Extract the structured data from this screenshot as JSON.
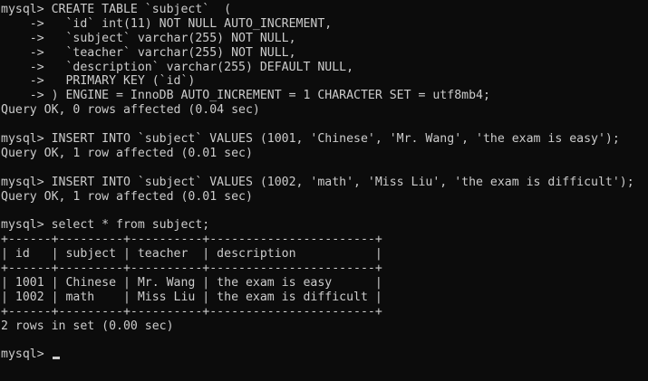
{
  "terminal": {
    "lines": [
      "mysql> CREATE TABLE `subject`  (",
      "    ->   `id` int(11) NOT NULL AUTO_INCREMENT,",
      "    ->   `subject` varchar(255) NOT NULL,",
      "    ->   `teacher` varchar(255) NOT NULL,",
      "    ->   `description` varchar(255) DEFAULT NULL,",
      "    ->   PRIMARY KEY (`id`)",
      "    -> ) ENGINE = InnoDB AUTO_INCREMENT = 1 CHARACTER SET = utf8mb4;",
      "Query OK, 0 rows affected (0.04 sec)",
      "",
      "mysql> INSERT INTO `subject` VALUES (1001, 'Chinese', 'Mr. Wang', 'the exam is easy');",
      "Query OK, 1 row affected (0.01 sec)",
      "",
      "mysql> INSERT INTO `subject` VALUES (1002, 'math', 'Miss Liu', 'the exam is difficult');",
      "Query OK, 1 row affected (0.01 sec)",
      "",
      "mysql> select * from subject;",
      "+------+---------+----------+-----------------------+",
      "| id   | subject | teacher  | description           |",
      "+------+---------+----------+-----------------------+",
      "| 1001 | Chinese | Mr. Wang | the exam is easy      |",
      "| 1002 | math    | Miss Liu | the exam is difficult |",
      "+------+---------+----------+-----------------------+",
      "2 rows in set (0.00 sec)",
      ""
    ],
    "prompt": "mysql> "
  }
}
